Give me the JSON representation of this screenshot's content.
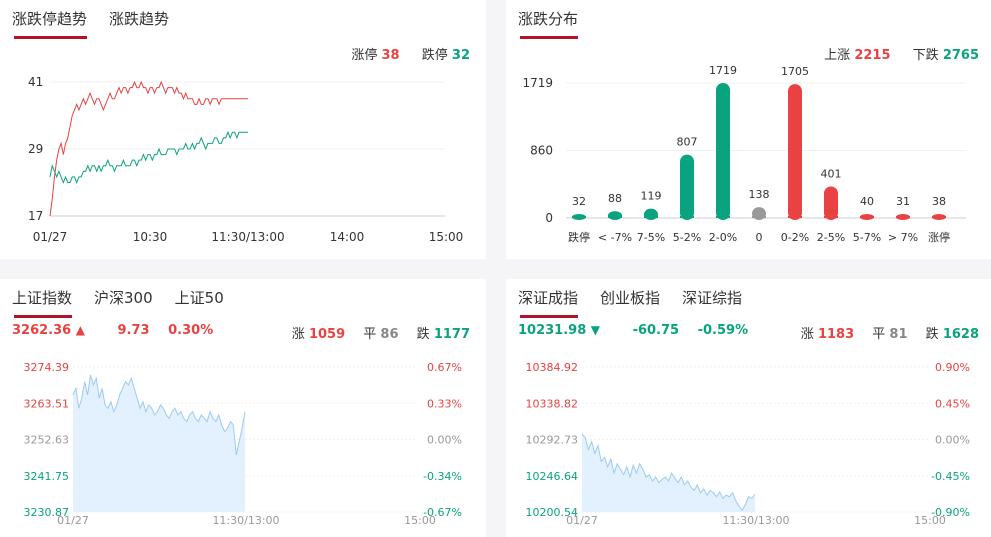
{
  "panel1": {
    "tabs": [
      {
        "label": "涨跌停趋势",
        "active": true
      },
      {
        "label": "涨跌趋势",
        "active": false
      }
    ],
    "limit_up_label": "涨停",
    "limit_up_value": "38",
    "limit_down_label": "跌停",
    "limit_down_value": "32",
    "chart_data": {
      "type": "line",
      "y_ticks": [
        "41",
        "29",
        "17"
      ],
      "ylim": [
        17,
        41
      ],
      "x_ticks": [
        "01/27",
        "10:30",
        "11:30/13:00",
        "14:00",
        "15:00"
      ],
      "series": [
        {
          "color": "#e84242",
          "values": [
            17,
            20,
            24,
            27,
            29,
            30,
            28,
            30,
            31,
            33,
            35,
            36,
            37,
            36,
            37,
            38,
            37,
            38,
            39,
            38,
            37,
            38,
            38,
            37,
            36,
            37,
            38,
            39,
            38,
            38,
            39,
            40,
            39,
            40,
            40,
            39,
            40,
            40,
            41,
            40,
            40,
            41,
            40,
            40,
            39,
            40,
            40,
            39,
            40,
            40,
            41,
            40,
            39,
            40,
            40,
            40,
            39,
            40,
            39,
            39,
            38,
            39,
            38,
            38,
            38,
            37,
            37,
            38,
            37,
            37,
            38,
            38,
            37,
            38,
            38,
            38,
            37,
            38,
            38,
            38,
            38,
            38,
            38,
            38,
            38,
            38,
            38,
            38,
            38,
            38
          ]
        },
        {
          "color": "#0aa37f",
          "values": [
            24,
            26,
            25,
            24,
            25,
            24,
            23,
            24,
            23,
            23,
            24,
            24,
            23,
            24,
            24,
            25,
            25,
            26,
            25,
            26,
            26,
            25,
            26,
            25,
            26,
            26,
            27,
            26,
            26,
            25,
            26,
            26,
            26,
            27,
            26,
            26,
            26,
            27,
            27,
            26,
            27,
            27,
            28,
            27,
            28,
            28,
            27,
            28,
            28,
            29,
            28,
            28,
            28,
            29,
            29,
            29,
            29,
            28,
            29,
            29,
            29,
            30,
            29,
            29,
            30,
            29,
            30,
            30,
            31,
            30,
            29,
            30,
            30,
            30,
            31,
            31,
            30,
            30,
            31,
            31,
            32,
            31,
            32,
            32,
            31,
            32,
            32,
            32,
            32,
            32
          ]
        }
      ]
    }
  },
  "panel2": {
    "tabs": [
      {
        "label": "涨跌分布",
        "active": true
      }
    ],
    "up_label": "上涨",
    "up_value": "2215",
    "down_label": "下跌",
    "down_value": "2765",
    "chart_data": {
      "type": "bar",
      "y_ticks": [
        "1719",
        "860",
        "0"
      ],
      "ylim": [
        0,
        1719
      ],
      "categories": [
        "跌停",
        "< -7%",
        "7-5%",
        "5-2%",
        "2-0%",
        "0",
        "0-2%",
        "2-5%",
        "5-7%",
        "> 7%",
        "涨停"
      ],
      "values": [
        32,
        88,
        119,
        807,
        1719,
        138,
        1705,
        401,
        40,
        31,
        38
      ],
      "colors": [
        "#0aa37f",
        "#0aa37f",
        "#0aa37f",
        "#0aa37f",
        "#0aa37f",
        "#999999",
        "#e84242",
        "#e84242",
        "#e84242",
        "#e84242",
        "#e84242"
      ]
    }
  },
  "panel3": {
    "tabs": [
      {
        "label": "上证指数",
        "active": true
      },
      {
        "label": "沪深300",
        "active": false
      },
      {
        "label": "上证50",
        "active": false
      }
    ],
    "price": "3262.36",
    "change": "9.73",
    "pct": "0.30%",
    "up_label": "涨",
    "up_value": "1059",
    "flat_label": "平",
    "flat_value": "86",
    "down_label": "跌",
    "down_value": "1177",
    "chart_data": {
      "type": "area",
      "y_ticks": [
        "3274.39",
        "3263.51",
        "3252.63",
        "3241.75",
        "3230.87"
      ],
      "pct_ticks": [
        "0.67%",
        "0.33%",
        "0.00%",
        "-0.34%",
        "-0.67%"
      ],
      "ylim": [
        3230.87,
        3274.39
      ],
      "x_ticks": [
        "01/27",
        "11:30/13:00",
        "15:00"
      ],
      "values": [
        3266,
        3268,
        3262,
        3265,
        3270,
        3266,
        3272,
        3269,
        3271,
        3265,
        3268,
        3263,
        3262,
        3264,
        3261,
        3263,
        3266,
        3268,
        3270,
        3269,
        3271,
        3268,
        3265,
        3262,
        3264,
        3261,
        3263,
        3262,
        3260,
        3261,
        3263,
        3262,
        3260,
        3259,
        3261,
        3262,
        3260,
        3261,
        3259,
        3258,
        3260,
        3261,
        3259,
        3258,
        3260,
        3259,
        3258,
        3261,
        3259,
        3258,
        3260,
        3257,
        3255,
        3256,
        3258,
        3257,
        3248,
        3252,
        3256,
        3261
      ]
    }
  },
  "panel4": {
    "tabs": [
      {
        "label": "深证成指",
        "active": true
      },
      {
        "label": "创业板指",
        "active": false
      },
      {
        "label": "深证综指",
        "active": false
      }
    ],
    "price": "10231.98",
    "change": "-60.75",
    "pct": "-0.59%",
    "up_label": "涨",
    "up_value": "1183",
    "flat_label": "平",
    "flat_value": "81",
    "down_label": "跌",
    "down_value": "1628",
    "chart_data": {
      "type": "area",
      "y_ticks": [
        "10384.92",
        "10338.82",
        "10292.73",
        "10246.64",
        "10200.54"
      ],
      "pct_ticks": [
        "0.90%",
        "0.45%",
        "0.00%",
        "-0.45%",
        "-0.90%"
      ],
      "ylim": [
        10200.54,
        10384.92
      ],
      "x_ticks": [
        "01/27",
        "11:30/13:00",
        "15:00"
      ],
      "values": [
        10300,
        10295,
        10280,
        10290,
        10275,
        10285,
        10265,
        10270,
        10258,
        10268,
        10250,
        10262,
        10255,
        10248,
        10258,
        10245,
        10260,
        10250,
        10262,
        10255,
        10245,
        10248,
        10240,
        10245,
        10238,
        10242,
        10245,
        10240,
        10250,
        10243,
        10238,
        10245,
        10235,
        10240,
        10232,
        10228,
        10235,
        10225,
        10230,
        10222,
        10228,
        10225,
        10220,
        10226,
        10218,
        10222,
        10220,
        10225,
        10215,
        10208,
        10203,
        10210,
        10220,
        10218,
        10223
      ]
    }
  }
}
